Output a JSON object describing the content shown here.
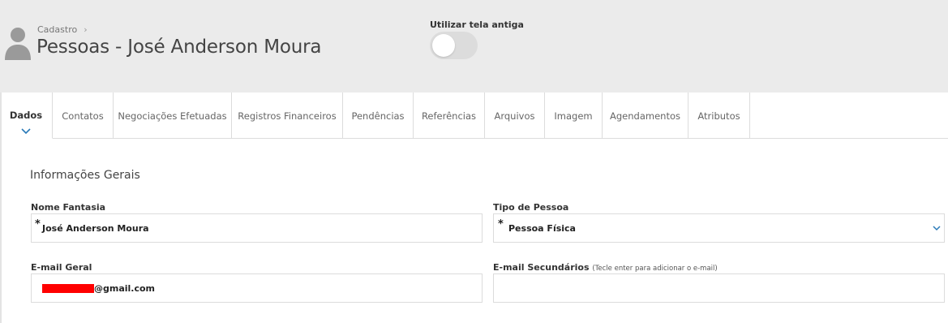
{
  "header": {
    "breadcrumb": "Cadastro",
    "title": "Pessoas - José Anderson Moura",
    "toggle_label": "Utilizar tela antiga",
    "toggle_on": false
  },
  "tabs": [
    {
      "label": "Dados",
      "active": true
    },
    {
      "label": "Contatos",
      "active": false
    },
    {
      "label": "Negociações Efetuadas",
      "active": false
    },
    {
      "label": "Registros Financeiros",
      "active": false
    },
    {
      "label": "Pendências",
      "active": false
    },
    {
      "label": "Referências",
      "active": false
    },
    {
      "label": "Arquivos",
      "active": false
    },
    {
      "label": "Imagem",
      "active": false
    },
    {
      "label": "Agendamentos",
      "active": false
    },
    {
      "label": "Atributos",
      "active": false
    }
  ],
  "form": {
    "section_title": "Informações Gerais",
    "nome_fantasia": {
      "label": "Nome Fantasia",
      "value": "José Anderson Moura",
      "required_mark": "*"
    },
    "tipo_pessoa": {
      "label": "Tipo de Pessoa",
      "value": "Pessoa Física",
      "required_mark": "*"
    },
    "email_geral": {
      "label": "E-mail Geral",
      "value_suffix": "@gmail.com"
    },
    "email_secundarios": {
      "label": "E-mail Secundários",
      "hint": "(Tecle enter para adicionar o e-mail)",
      "value": ""
    }
  },
  "colors": {
    "header_bg": "#ebebeb",
    "accent": "#2a7ab8",
    "redaction": "#ff0000"
  }
}
